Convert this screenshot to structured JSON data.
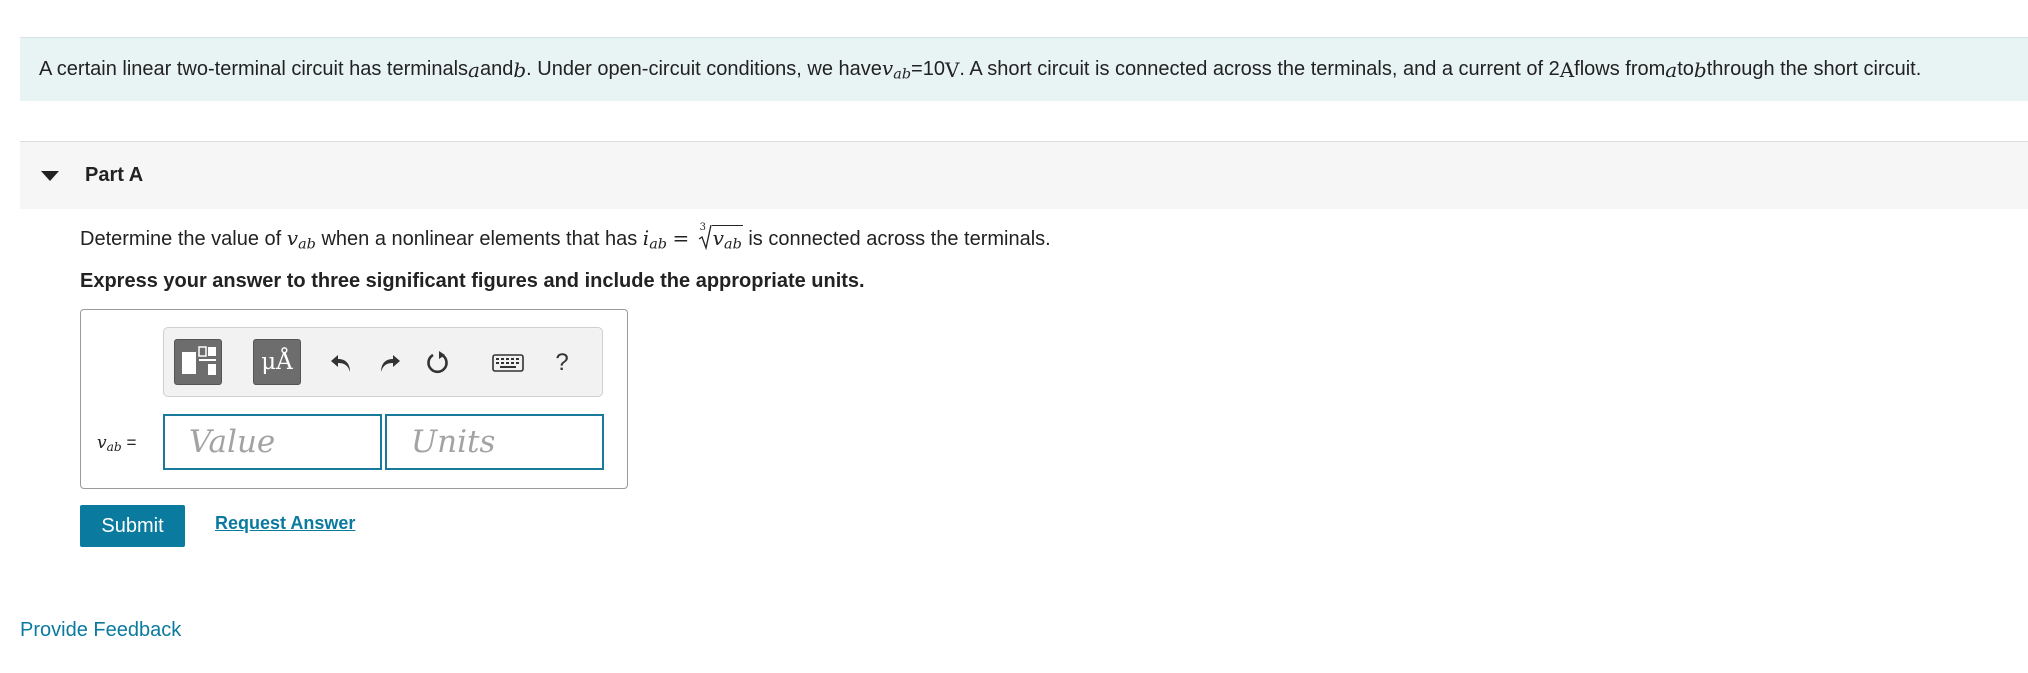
{
  "intro": {
    "t1": "A certain linear two-terminal circuit has terminals ",
    "a": "a",
    "t2": " and ",
    "b": "b",
    "t3": ". Under open-circuit conditions, we have ",
    "v": "v",
    "ab": "ab",
    "t4": " =10 ",
    "unit_V": "V",
    "t5": ". A short circuit is connected across the terminals, and a current of 2 ",
    "unit_A": "A",
    "t6": " flows from ",
    "t7": " to ",
    "t8": " through the short circuit."
  },
  "part": {
    "title": "Part A",
    "question": {
      "t1": "Determine the value of ",
      "v": "v",
      "ab": "ab",
      "t2": " when a nonlinear elements that has ",
      "i": "i",
      "eq": " = ",
      "root_index": "3",
      "t3": " is connected across the terminals."
    },
    "instruction": "Express your answer to three significant figures and include the appropriate units."
  },
  "answer": {
    "var_v": "v",
    "var_sub": "ab",
    "equals": "=",
    "value_placeholder": "Value",
    "units_placeholder": "Units",
    "units_button": "μÅ",
    "help": "?"
  },
  "actions": {
    "submit": "Submit",
    "request": "Request Answer",
    "feedback": "Provide Feedback"
  },
  "colors": {
    "accent": "#0a7a9e",
    "intro_bg": "#e8f4f4"
  }
}
